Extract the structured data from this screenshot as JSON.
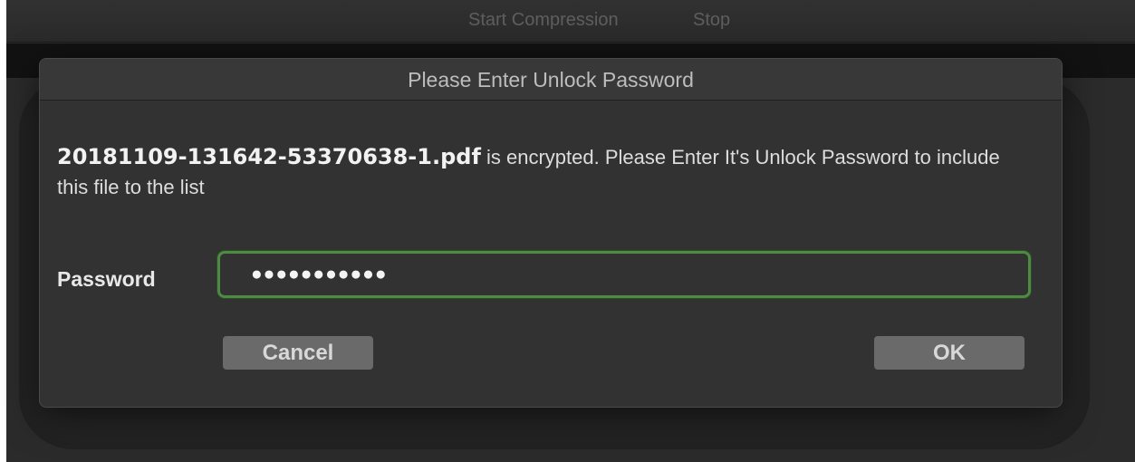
{
  "toolbar": {
    "start_label": "Start Compression",
    "stop_label": "Stop"
  },
  "dialog": {
    "title": "Please Enter Unlock Password",
    "filename": "20181109-131642-53370638-1.pdf",
    "message": " is encrypted. Please Enter It's Unlock Password to include this file to the list",
    "password_label": "Password",
    "password_masked": "●●●●●●●●●●●",
    "cancel_label": "Cancel",
    "ok_label": "OK"
  },
  "colors": {
    "focus_ring": "#4f8a45",
    "dialog_bg": "#323232",
    "button_bg": "#6a6a6a"
  }
}
